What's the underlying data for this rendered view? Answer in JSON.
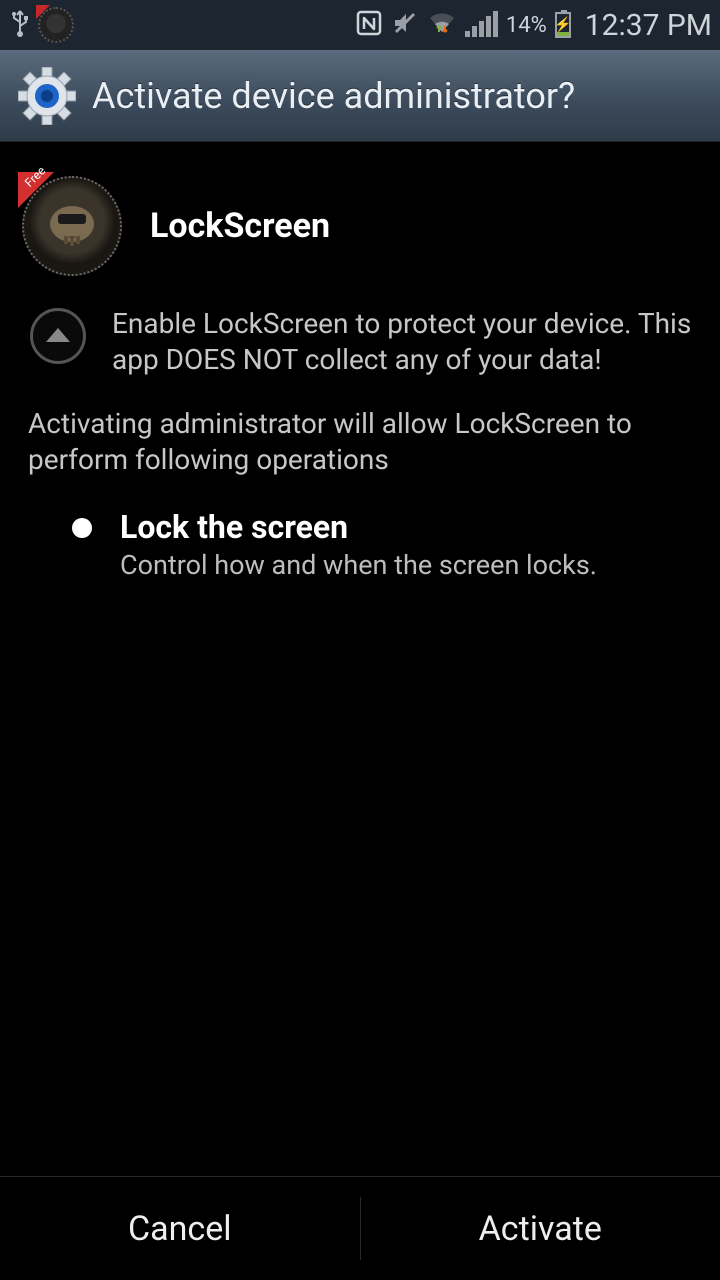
{
  "status": {
    "battery_text": "14%",
    "clock": "12:37 PM"
  },
  "header": {
    "title": "Activate device administrator?"
  },
  "app": {
    "name": "LockScreen",
    "badge": "Free",
    "description": "Enable LockScreen to protect your device. This app DOES NOT collect any of your data!"
  },
  "operations": {
    "intro": "Activating administrator will allow LockScreen to perform following operations",
    "items": [
      {
        "title": "Lock the screen",
        "subtitle": "Control how and when the screen locks."
      }
    ]
  },
  "buttons": {
    "cancel": "Cancel",
    "activate": "Activate"
  }
}
